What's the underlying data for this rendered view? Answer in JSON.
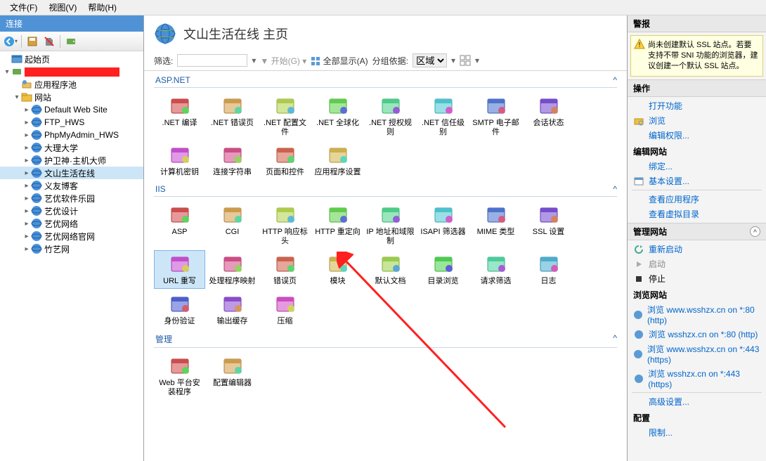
{
  "menu": {
    "file": "文件(F)",
    "view": "视图(V)",
    "help": "帮助(H)"
  },
  "panels": {
    "left_title": "连接",
    "right_alerts": "警报",
    "right_actions": "操作"
  },
  "tree": {
    "start": "起始页",
    "server_redacted": "",
    "app_pool": "应用程序池",
    "sites": "网站",
    "children": [
      "Default Web Site",
      "FTP_HWS",
      "PhpMyAdmin_HWS",
      "大理大学",
      "护卫神·主机大师",
      "文山生活在线",
      "义友博客",
      "艺优软件乐园",
      "艺优设计",
      "艺优网络",
      "艺优网络官网",
      "竹艺网"
    ]
  },
  "center": {
    "title": "文山生活在线 主页",
    "filter_label": "筛选:",
    "start_label": "开始(G)",
    "show_all": "全部显示(A)",
    "group_by": "分组依据:",
    "group_value": "区域"
  },
  "groups": {
    "aspnet": "ASP.NET",
    "iis": "IIS",
    "mgmt": "管理"
  },
  "items_aspnet": [
    ".NET 编译",
    ".NET 错误页",
    ".NET 配置文件",
    ".NET 全球化",
    ".NET 授权规则",
    ".NET 信任级别",
    "SMTP 电子邮件",
    "会话状态",
    "计算机密钥",
    "连接字符串",
    "页面和控件",
    "应用程序设置"
  ],
  "items_iis": [
    "ASP",
    "CGI",
    "HTTP 响应标头",
    "HTTP 重定向",
    "IP 地址和域限制",
    "ISAPI 筛选器",
    "MIME 类型",
    "SSL 设置",
    "URL 重写",
    "处理程序映射",
    "错误页",
    "模块",
    "默认文档",
    "目录浏览",
    "请求筛选",
    "日志",
    "身份验证",
    "输出缓存",
    "压缩"
  ],
  "items_mgmt": [
    "Web 平台安装程序",
    "配置编辑器"
  ],
  "alert_text": "尚未创建默认 SSL 站点。若要支持不带 SNI 功能的浏览器，建议创建一个默认 SSL 站点。",
  "actions": {
    "open_feature": "打开功能",
    "explore": "浏览",
    "edit_perm": "编辑权限...",
    "edit_site": "编辑网站",
    "bindings": "绑定...",
    "basic": "基本设置...",
    "view_apps": "查看应用程序",
    "view_vdirs": "查看虚拟目录",
    "manage_site": "管理网站",
    "restart": "重新启动",
    "start": "启动",
    "stop": "停止",
    "browse_site": "浏览网站",
    "browse1": "浏览 www.wsshzx.cn on *:80 (http)",
    "browse2": "浏览 wsshzx.cn on *:80 (http)",
    "browse3": "浏览 www.wsshzx.cn on *:443 (https)",
    "browse4": "浏览 wsshzx.cn on *:443 (https)",
    "advanced": "高级设置...",
    "config": "配置",
    "limits": "限制..."
  }
}
